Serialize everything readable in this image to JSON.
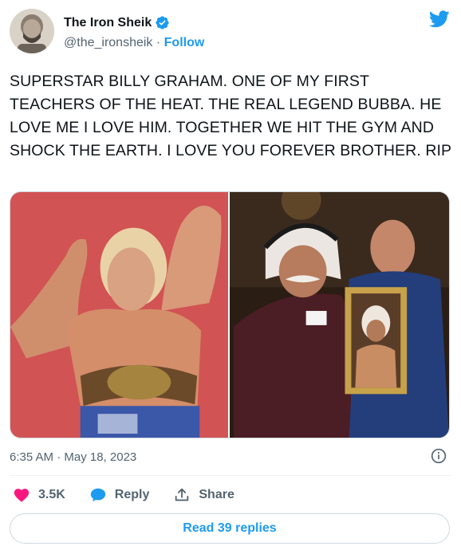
{
  "author": {
    "name": "The Iron Sheik",
    "handle": "@the_ironsheik",
    "separator": "·",
    "follow_label": "Follow"
  },
  "tweet": {
    "text": "SUPERSTAR BILLY GRAHAM. ONE OF MY FIRST TEACHERS OF THE HEAT. THE REAL LEGEND BUBBA. HE LOVE ME I LOVE HIM. TOGETHER WE HIT THE GYM AND SHOCK THE EARTH. I LOVE YOU FOREVER BROTHER. RIP",
    "timestamp": "6:35 AM · May 18, 2023"
  },
  "media": {
    "images": [
      "wrestler-flexing-with-belt-photo",
      "two-men-holding-portrait-photo"
    ]
  },
  "actions": {
    "like_count": "3.5K",
    "reply_label": "Reply",
    "share_label": "Share",
    "read_replies_label": "Read 39 replies"
  },
  "icons": {
    "verified": "verified-badge-icon",
    "brand": "twitter-bird-icon",
    "info": "info-icon",
    "like": "heart-icon",
    "reply": "speech-bubble-icon",
    "share": "upload-arrow-icon"
  },
  "colors": {
    "accent": "#1d9bf0",
    "like": "#f91880",
    "text": "#0f1419",
    "muted": "#536471"
  }
}
